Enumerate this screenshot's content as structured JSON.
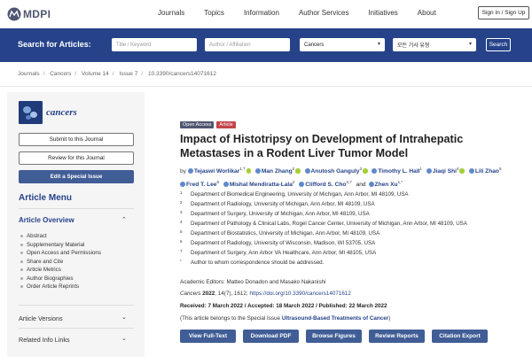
{
  "header": {
    "logo_text": "MDPI",
    "nav": [
      "Journals",
      "Topics",
      "Information",
      "Author Services",
      "Initiatives",
      "About"
    ],
    "signin": "Sign In / Sign Up"
  },
  "search": {
    "label": "Search for Articles:",
    "title_placeholder": "Title / Keyword",
    "author_placeholder": "Author / Affiliation",
    "journal_value": "Cancers",
    "type_value": "모든 기사 유형",
    "button": "Search"
  },
  "breadcrumb": [
    "Journals",
    "Cancers",
    "Volume 14",
    "Issue 7",
    "10.3390/cancers14071612"
  ],
  "sidebar": {
    "journal_name": "cancers",
    "buttons": [
      "Submit to this Journal",
      "Review for this Journal",
      "Edit a Special Issue"
    ],
    "menu_title": "Article Menu",
    "overview_title": "Article Overview",
    "overview_items": [
      "Abstract",
      "Supplementary Material",
      "Open Access and Permissions",
      "Share and Cite",
      "Article Metrics",
      "Author Biographies",
      "Order Article Reprints"
    ],
    "sections": [
      "Article Versions",
      "Related Info Links"
    ]
  },
  "article": {
    "badge_open": "Open Access",
    "badge_type": "Article",
    "title": "Impact of Histotripsy on Development of Intrahepatic Metastases in a Rodent Liver Tumor Model",
    "by": "by",
    "authors": [
      {
        "name": "Tejaswi Worlikar",
        "sup": "1,†",
        "orcid": true
      },
      {
        "name": "Man Zhang",
        "sup": "2",
        "orcid": true
      },
      {
        "name": "Anutosh Ganguly",
        "sup": "3",
        "orcid": true
      },
      {
        "name": "Timothy L. Hall",
        "sup": "1",
        "orcid": false
      },
      {
        "name": "Jiaqi Shi",
        "sup": "4",
        "orcid": true
      },
      {
        "name": "Lili Zhao",
        "sup": "5",
        "orcid": false
      },
      {
        "name": "Fred T. Lee",
        "sup": "6",
        "orcid": false
      },
      {
        "name": "Mishal Mendiratta-Lala",
        "sup": "2",
        "orcid": false
      },
      {
        "name": "Clifford S. Cho",
        "sup": "3,7",
        "orcid": false
      },
      {
        "name": "Zhen Xu",
        "sup": "1,*",
        "orcid": false
      }
    ],
    "and_word": "and",
    "affiliations": [
      {
        "num": "1",
        "text": "Department of Biomedical Engineering, University of Michigan, Ann Arbor, MI 48109, USA"
      },
      {
        "num": "2",
        "text": "Department of Radiology, University of Michigan, Ann Arbor, MI 48109, USA"
      },
      {
        "num": "3",
        "text": "Department of Surgery, University of Michigan, Ann Arbor, MI 48109, USA"
      },
      {
        "num": "4",
        "text": "Department of Pathology & Clinical Labs, Rogel Cancer Center, University of Michigan, Ann Arbor, MI 48109, USA"
      },
      {
        "num": "5",
        "text": "Department of Biostatistics, University of Michigan, Ann Arbor, MI 48109, USA"
      },
      {
        "num": "6",
        "text": "Department of Radiology, University of Wisconsin, Madison, WI 53705, USA"
      },
      {
        "num": "7",
        "text": "Department of Surgery, Ann Arbor VA Healthcare, Ann Arbor, MI 48105, USA"
      },
      {
        "num": "*",
        "text": "Author to whom correspondence should be addressed."
      }
    ],
    "editors": "Academic Editors: Matteo Donadon and Masako Nakanishi",
    "citation_journal": "Cancers",
    "citation_year": "2022",
    "citation_rest": ", 14(7), 1612;",
    "doi": "https://doi.org/10.3390/cancers14071612",
    "dates": "Received: 7 March 2022 / Accepted: 18 March 2022 / Published: 22 March 2022",
    "special_prefix": "(This article belongs to the Special Issue ",
    "special_issue": "Ultrasound-Based Treatments of Cancer",
    "special_suffix": ")",
    "actions": [
      "View Full-Text",
      "Download PDF",
      "Browse Figures",
      "Review Reports",
      "Citation Export"
    ]
  },
  "colors": {
    "brand": "#26438a",
    "button": "#415d96",
    "article_badge": "#c3454b",
    "orcid": "#a6ce39"
  }
}
